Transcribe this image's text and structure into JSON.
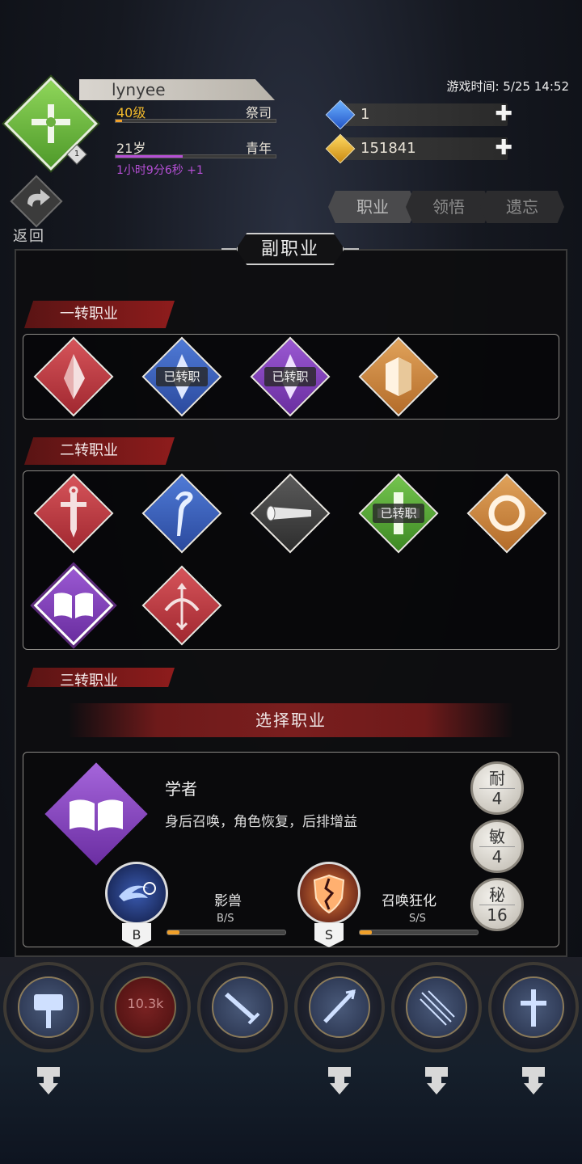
{
  "player": {
    "name": "lynyee",
    "level": "40级",
    "class": "祭司",
    "age": "21岁",
    "age_stage": "青年",
    "age_timer": "1小时9分6秒 +1",
    "emblem_level": "1",
    "level_progress": 0.04,
    "age_progress": 0.42
  },
  "header": {
    "game_time": "游戏时间: 5/25 14:52",
    "back_label": "返回"
  },
  "currency": {
    "gems": "1",
    "gold": "151841"
  },
  "tabs": [
    {
      "label": "职业",
      "active": true
    },
    {
      "label": "领悟",
      "active": false
    },
    {
      "label": "遗忘",
      "active": false
    }
  ],
  "panel": {
    "title": "副职业",
    "sections": [
      {
        "label": "一转职业"
      },
      {
        "label": "二转职业"
      },
      {
        "label": "三转职业"
      }
    ],
    "transferred_badge": "已转职",
    "select_label": "选择职业"
  },
  "tier1_jobs": [
    {
      "icon": "crystal-icon",
      "color": "red",
      "transferred": false
    },
    {
      "icon": "crystal-icon",
      "color": "blue",
      "transferred": true
    },
    {
      "icon": "crystal-icon",
      "color": "purple",
      "transferred": true
    },
    {
      "icon": "shield-icon",
      "color": "orange",
      "transferred": false
    }
  ],
  "tier2_jobs": [
    {
      "icon": "sword-icon",
      "color": "red",
      "transferred": false
    },
    {
      "icon": "staff-icon",
      "color": "blue",
      "transferred": false
    },
    {
      "icon": "scroll-icon",
      "color": "gray",
      "transferred": false
    },
    {
      "icon": "cross-icon",
      "color": "green",
      "transferred": true
    },
    {
      "icon": "ring-icon",
      "color": "orange",
      "transferred": false
    },
    {
      "icon": "book-icon",
      "color": "purple",
      "transferred": false,
      "selected": true
    },
    {
      "icon": "bow-icon",
      "color": "red",
      "transferred": false
    }
  ],
  "selected_job": {
    "name": "学者",
    "description": "身后召唤，角色恢复，后排增益",
    "attributes": [
      {
        "key": "耐",
        "value": "4"
      },
      {
        "key": "敏",
        "value": "4"
      },
      {
        "key": "秘",
        "value": "16"
      }
    ],
    "skills": [
      {
        "name": "影兽",
        "rank": "B",
        "grade": "B/S",
        "progress": 0.1
      },
      {
        "name": "召唤狂化",
        "rank": "S",
        "grade": "S/S",
        "progress": 0.1
      }
    ]
  },
  "bottom_slots": [
    {
      "icon": "hammer-icon"
    },
    {
      "icon": "counter",
      "text": "10.3k"
    },
    {
      "icon": "sword-icon"
    },
    {
      "icon": "spear-icon"
    },
    {
      "icon": "arrows-icon"
    },
    {
      "icon": "holy-cross-icon"
    }
  ],
  "colors": {
    "red": "#c0383f",
    "blue": "#3b62c0",
    "purple": "#8543bf",
    "orange": "#cd8840",
    "gray": "#444444",
    "green": "#5aaa3a",
    "accent_ribbon": "#7a1e1e",
    "age_timer": "#b64fd6",
    "progress_orange": "#f0a02a"
  }
}
